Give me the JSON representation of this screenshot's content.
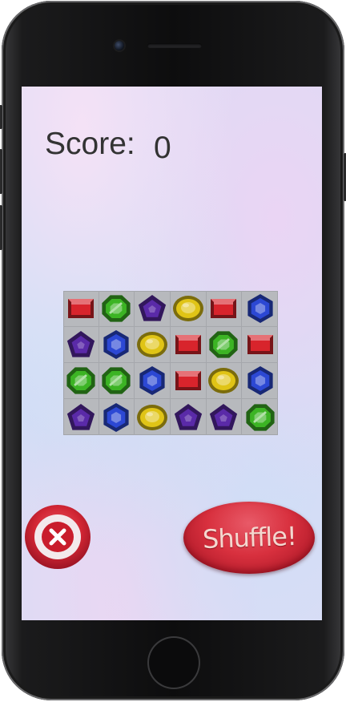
{
  "score": {
    "label": "Score:",
    "value": "0"
  },
  "board": {
    "rows": 4,
    "cols": 6,
    "cells": [
      [
        "ruby",
        "emerald",
        "amethyst",
        "topaz",
        "ruby",
        "sapphire"
      ],
      [
        "amethyst",
        "sapphire",
        "topaz",
        "ruby",
        "emerald",
        "ruby"
      ],
      [
        "emerald",
        "emerald",
        "sapphire",
        "ruby",
        "topaz",
        "sapphire"
      ],
      [
        "amethyst",
        "sapphire",
        "topaz",
        "amethyst",
        "amethyst",
        "emerald"
      ]
    ]
  },
  "gem_colors": {
    "ruby": "#d8242c",
    "emerald": "#3cb424",
    "amethyst": "#5a2aa8",
    "topaz": "#e0c416",
    "sapphire": "#2c48d4"
  },
  "buttons": {
    "quit_icon": "close-icon",
    "shuffle_label": "Shuffle!"
  },
  "colors": {
    "button_red": "#d8303e",
    "shuffle_text": "#f4d7cf"
  }
}
